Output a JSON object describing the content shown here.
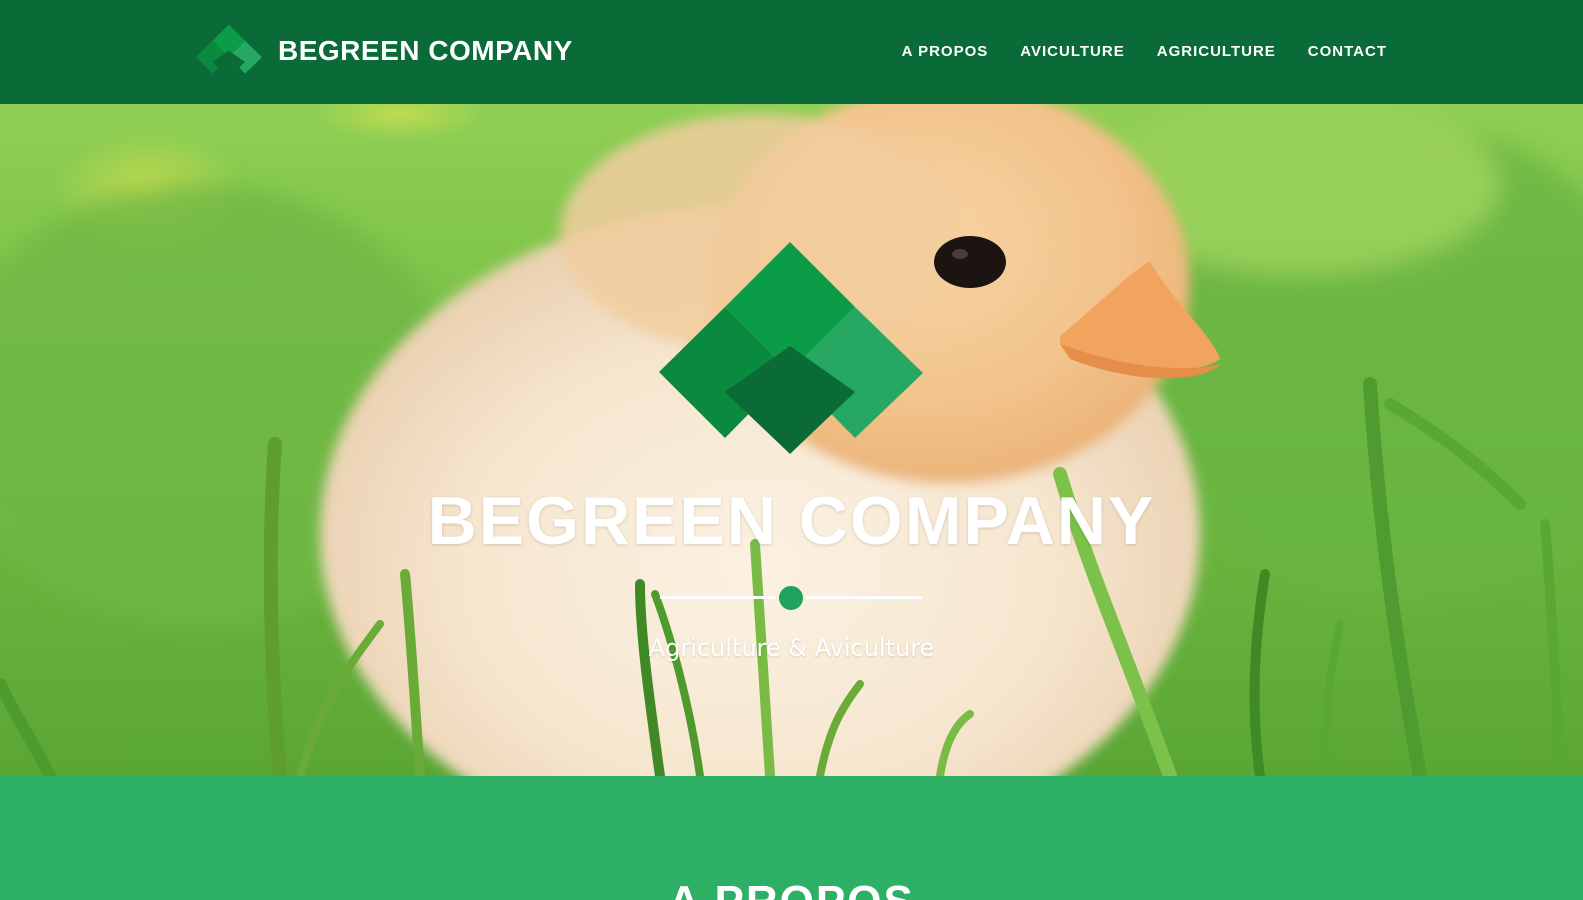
{
  "brand": {
    "name": "BEGREEN COMPANY",
    "logo_icon": "begreen-diamond-logo"
  },
  "nav": {
    "items": [
      {
        "label": "A PROPOS"
      },
      {
        "label": "AVICULTURE"
      },
      {
        "label": "AGRICULTURE"
      },
      {
        "label": "CONTACT"
      }
    ]
  },
  "hero": {
    "title": "BEGREEN COMPANY",
    "subtitle": "Agriculture & Aviculture",
    "background": "chick-in-grass-photo"
  },
  "about": {
    "heading": "A PROPOS"
  },
  "colors": {
    "navbar": "#0a6b38",
    "accent": "#2eaf66",
    "logo_light": "#27a862",
    "logo_mid": "#0c9c48",
    "logo_dark": "#0b6b37"
  }
}
